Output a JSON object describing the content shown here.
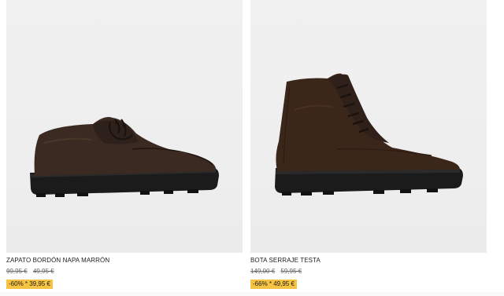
{
  "products": [
    {
      "name": "ZAPATO BORDÓN NAPA MARRÓN",
      "original_price": "99,95 €",
      "previous_price": "49,95 €",
      "discount_label": "-60% * 39,95 €",
      "image_icon": "derby-shoe-icon"
    },
    {
      "name": "BOTA SERRAJE TESTA",
      "original_price": "149,00 €",
      "previous_price": "59,95 €",
      "discount_label": "-66% * 49,95 €",
      "image_icon": "lace-up-boot-icon"
    }
  ],
  "colors": {
    "badge": "#f6c343",
    "shoe_leather": "#3a2a22",
    "boot_suede": "#3b261a",
    "sole": "#1b1b1b",
    "background": "#efefef"
  }
}
